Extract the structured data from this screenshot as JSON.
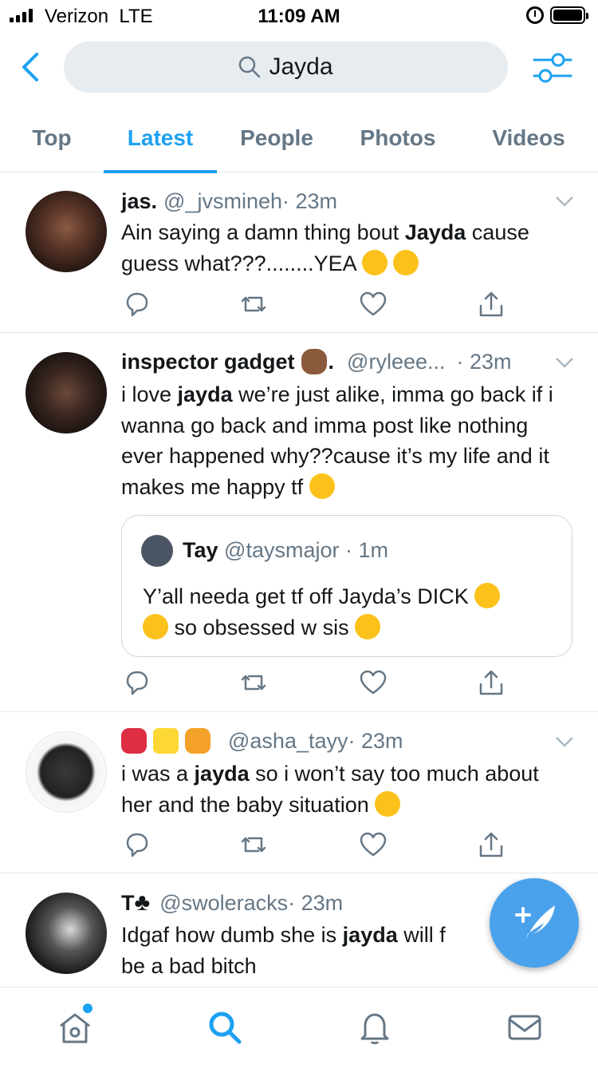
{
  "status_bar": {
    "carrier": "Verizon",
    "network": "LTE",
    "time": "11:09 AM"
  },
  "search": {
    "query": "Jayda"
  },
  "tabs": [
    {
      "label": "Top",
      "active": false
    },
    {
      "label": "Latest",
      "active": true
    },
    {
      "label": "People",
      "active": false
    },
    {
      "label": "Photos",
      "active": false
    },
    {
      "label": "Videos",
      "active": false
    }
  ],
  "tweets": [
    {
      "name": "jas.",
      "handle": "@_jvsmineh",
      "time": "· 23m",
      "text_before": "Ain saying a damn thing bout ",
      "highlight": "Jayda",
      "text_after": " cause guess what???........YEA"
    },
    {
      "name": "inspector gadget",
      "name_suffix": ".",
      "handle": "@ryleee...",
      "time": "· 23m",
      "text_before": "i love ",
      "highlight": "jayda",
      "text_after": " we’re just alike, imma go back if i wanna go back and imma post like nothing ever happened why??cause it’s my life and it makes me happy tf",
      "quote": {
        "name": "Tay",
        "handle": "@taysmajor",
        "time": "· 1m",
        "text_line1": "Y’all needa get tf off Jayda’s DICK",
        "text_line2": "so obsessed w sis"
      }
    },
    {
      "name": "",
      "handle": "@asha_tayy",
      "time": "· 23m",
      "text_before": "i was a ",
      "highlight": "jayda",
      "text_after": " so i won’t say too much about her and the baby situation"
    },
    {
      "name": "T",
      "handle": "@swoleracks",
      "time": "· 23m",
      "text_before": "Idgaf how dumb she is ",
      "highlight": "jayda",
      "text_after": " will f",
      "text_line2": "be a bad bitch"
    }
  ],
  "colors": {
    "accent": "#1da1f2",
    "secondary_text": "#657786",
    "search_bg": "#e6ecf0",
    "fab": "#4aa1ec"
  },
  "icons": {
    "back": "chevron-left-icon",
    "search": "search-icon",
    "filter": "sliders-icon",
    "reply": "reply-icon",
    "retweet": "retweet-icon",
    "like": "heart-icon",
    "share": "share-icon",
    "compose": "compose-tweet-icon",
    "home": "home-icon",
    "explore": "search-icon",
    "notifications": "bell-icon",
    "messages": "mail-icon"
  }
}
